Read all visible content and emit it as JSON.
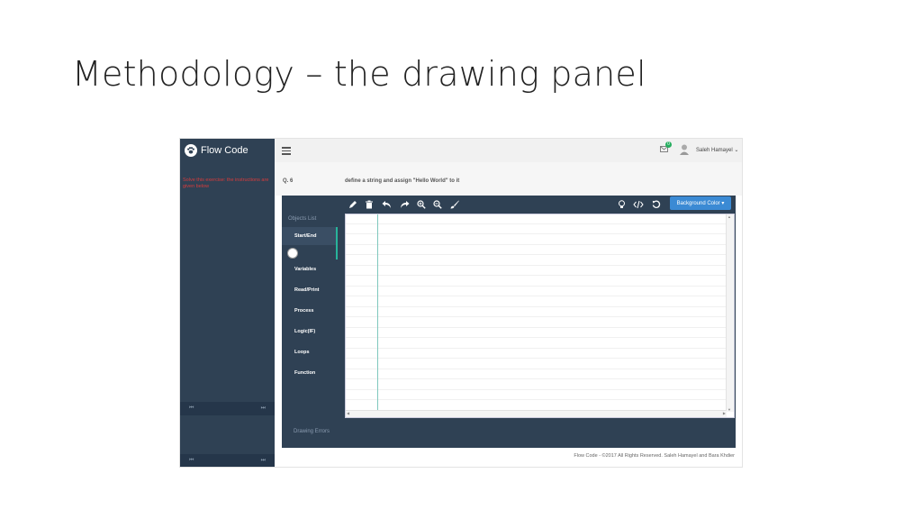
{
  "slide": {
    "title": "Methodology – the drawing panel"
  },
  "app": {
    "brand": "Flow Code",
    "sidebar_message": "Solve this exercise: the instructions are given below",
    "sidebar_nav": {
      "first": "⏮",
      "last": "⏭"
    },
    "header": {
      "notification_count": "0",
      "username": "Saleh Hamayel ⌄"
    },
    "question": {
      "label": "Q. 6",
      "text": "define a string and assign \"Hello World\" to it"
    },
    "objects_panel": {
      "title": "Objects List",
      "items": [
        "Start/End",
        "Variables",
        "Read/Print",
        "Process",
        "Logic(IF)",
        "Loops",
        "Function"
      ],
      "errors_label": "Drawing Errors"
    },
    "toolbar": {
      "background_color_label": "Background Color ▾"
    },
    "footer": {
      "text": "Flow Code - ©2017 All Rights Reserved. Saleh Hamayel and Bara Khdier"
    },
    "colors": {
      "sidebar": "#2f4154",
      "accent": "#28b49b",
      "button": "#3b8ad4",
      "error_text": "#d93c3c"
    }
  }
}
